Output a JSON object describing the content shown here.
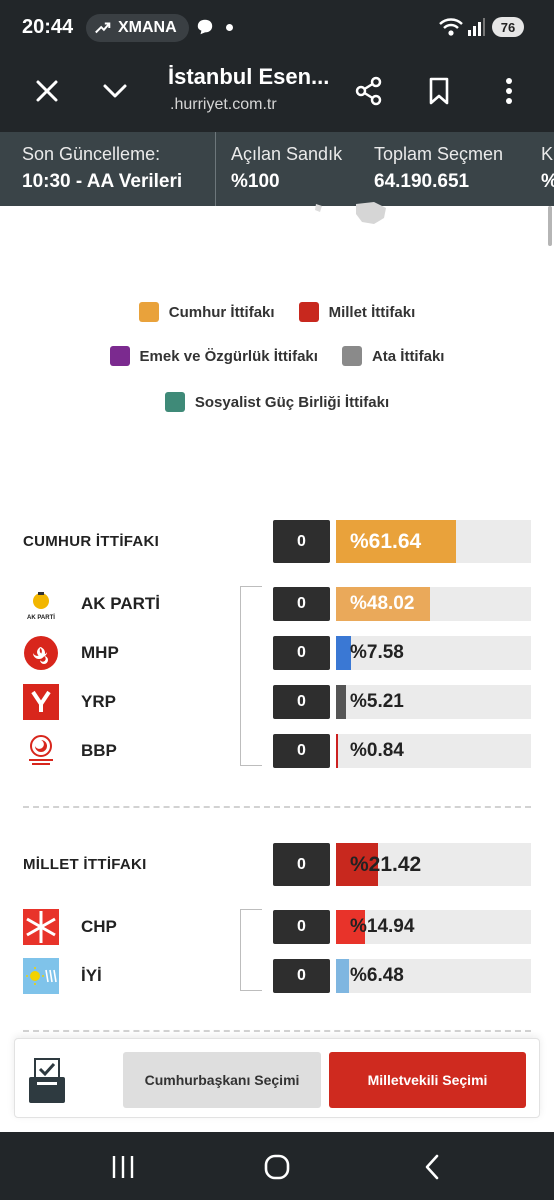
{
  "status_bar": {
    "time": "20:44",
    "trend_label": "XMANA",
    "battery": "76",
    "icons": [
      "trending-up-icon",
      "chat-bubble-icon",
      "wifi-icon",
      "signal-icon",
      "battery-icon"
    ]
  },
  "browser": {
    "title": "İstanbul Esen...",
    "url": ".hurriyet.com.tr",
    "icons": [
      "close-icon",
      "chevron-down-icon",
      "share-icon",
      "bookmark-icon",
      "more-vert-icon"
    ]
  },
  "info": {
    "items": [
      {
        "label": "Son Güncelleme:",
        "value": "10:30 - AA Verileri"
      },
      {
        "label": "Açılan Sandık",
        "value": "%100"
      },
      {
        "label": "Toplam Seçmen",
        "value": "64.190.651"
      },
      {
        "label": "K",
        "value": "%"
      }
    ]
  },
  "legend": {
    "items": [
      {
        "label": "Cumhur İttifakı",
        "color": "#e9a23b"
      },
      {
        "label": "Millet İttifakı",
        "color": "#c8281e"
      },
      {
        "label": "Emek ve Özgürlük İttifakı",
        "color": "#7b2a8f"
      },
      {
        "label": "Ata İttifakı",
        "color": "#8a8a8a"
      },
      {
        "label": "Sosyalist Güç Birliği İttifakı",
        "color": "#3f8a78"
      }
    ]
  },
  "alliances": [
    {
      "name": "CUMHUR İTTİFAKI",
      "count": "0",
      "pct_label": "%61.64",
      "pct": 61.64,
      "color": "#e9a23b",
      "parties": [
        {
          "name": "AK PARTİ",
          "count": "0",
          "pct_label": "%48.02",
          "pct": 48.02,
          "color": "#eaa95a",
          "logo": "ak-parti-logo-icon"
        },
        {
          "name": "MHP",
          "count": "0",
          "pct_label": "%7.58",
          "pct": 7.58,
          "color": "#3a78d4",
          "logo": "mhp-logo-icon"
        },
        {
          "name": "YRP",
          "count": "0",
          "pct_label": "%5.21",
          "pct": 5.21,
          "color": "#555555",
          "logo": "yrp-logo-icon"
        },
        {
          "name": "BBP",
          "count": "0",
          "pct_label": "%0.84",
          "pct": 0.84,
          "color": "#cc2020",
          "logo": "bbp-logo-icon"
        }
      ]
    },
    {
      "name": "MİLLET İTTİFAKI",
      "count": "0",
      "pct_label": "%21.42",
      "pct": 21.42,
      "color": "#c8281e",
      "parties": [
        {
          "name": "CHP",
          "count": "0",
          "pct_label": "%14.94",
          "pct": 14.94,
          "color": "#e8332a",
          "logo": "chp-logo-icon"
        },
        {
          "name": "İYİ",
          "count": "0",
          "pct_label": "%6.48",
          "pct": 6.48,
          "color": "#7fb6e0",
          "logo": "iyi-logo-icon"
        }
      ]
    }
  ],
  "bottom": {
    "presidential_label": "Cumhurbaşkanı Seçimi",
    "parliamentary_label": "Milletvekili Seçimi",
    "icon": "ballot-box-icon"
  },
  "nav": {
    "icons": [
      "recent-apps-icon",
      "home-icon",
      "back-icon"
    ]
  }
}
